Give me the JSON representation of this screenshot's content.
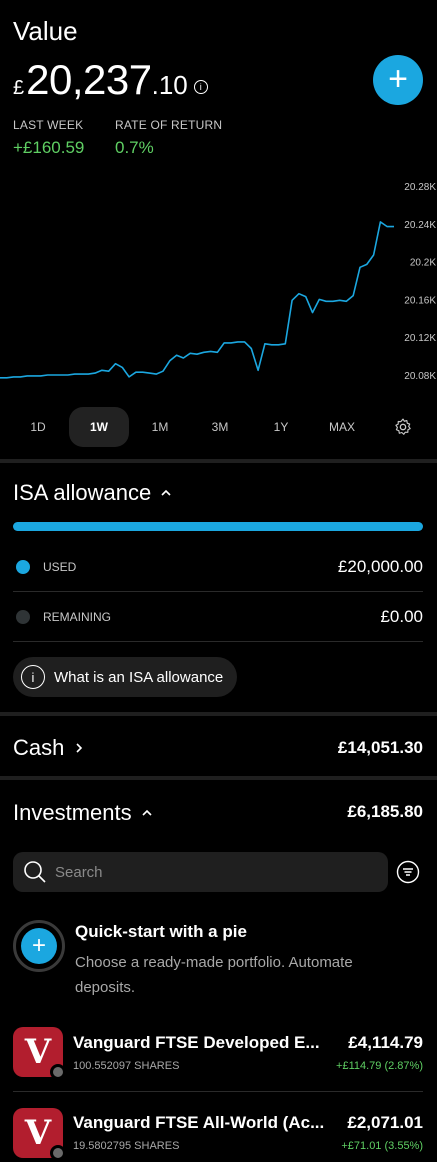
{
  "header": {
    "title": "Value",
    "currency_symbol": "£",
    "amount_main": "20,237",
    "amount_decimal": ".10",
    "info_icon": "info-icon",
    "add_button_icon": "plus-icon"
  },
  "stats": {
    "last_week_label": "LAST WEEK",
    "last_week_value": "+£160.59",
    "rate_label": "RATE OF RETURN",
    "rate_value": "0.7%"
  },
  "chart_data": {
    "type": "line",
    "y_ticks": [
      "20.28K",
      "20.24K",
      "20.2K",
      "20.16K",
      "20.12K",
      "20.08K"
    ],
    "ylim": [
      20080,
      20280
    ],
    "line_color": "#1ba7e0",
    "grid": false,
    "series": [
      {
        "values": [
          20077,
          20077,
          20078,
          20078,
          20079,
          20079,
          20079,
          20080,
          20080,
          20080,
          20080,
          20081,
          20081,
          20081,
          20082,
          20085,
          20084,
          20092,
          20088,
          20078,
          20083,
          20083,
          20082,
          20081,
          20084,
          20095,
          20101,
          20098,
          20103,
          20102,
          20104,
          20105,
          20104,
          20114,
          20114,
          20115,
          20115,
          20108,
          20085,
          20113,
          20112,
          20112,
          20113,
          20159,
          20166,
          20163,
          20146,
          20160,
          20158,
          20158,
          20159,
          20158,
          20164,
          20194,
          20197,
          20207,
          20242,
          20237,
          20237
        ]
      }
    ]
  },
  "ranges": {
    "items": [
      "1D",
      "1W",
      "1M",
      "3M",
      "1Y",
      "MAX"
    ],
    "active": "1W",
    "settings_icon": "gear-icon"
  },
  "isa": {
    "title": "ISA allowance",
    "used_fraction": 1.0,
    "used_label": "USED",
    "used_value": "£20,000.00",
    "used_color": "#1ba7e0",
    "remaining_label": "REMAINING",
    "remaining_value": "£0.00",
    "remaining_color": "#2f3436",
    "info_label": "What is an ISA allowance"
  },
  "cash": {
    "title": "Cash",
    "value": "£14,051.30"
  },
  "investments": {
    "title": "Investments",
    "value": "£6,185.80",
    "search_placeholder": "Search",
    "quickstart_title": "Quick-start with a pie",
    "quickstart_desc": "Choose a ready-made portfolio. Automate deposits.",
    "holdings": [
      {
        "name": "Vanguard FTSE Developed E...",
        "shares": "100.552097 SHARES",
        "value": "£4,114.79",
        "return": "+£114.79 (2.87%)",
        "logo": "V"
      },
      {
        "name": "Vanguard FTSE All-World (Ac...",
        "shares": "19.5802795 SHARES",
        "value": "£2,071.01",
        "return": "+£71.01 (3.55%)",
        "logo": "V"
      }
    ]
  }
}
